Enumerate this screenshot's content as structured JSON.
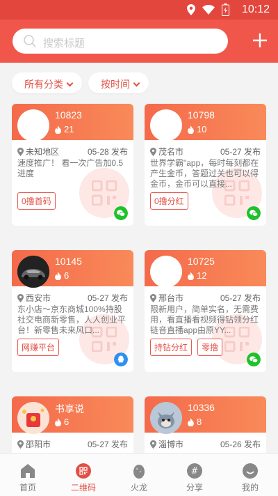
{
  "status_bar": {
    "time": "10:12"
  },
  "search": {
    "placeholder": "搜索标题"
  },
  "filters": [
    {
      "label": "所有分类"
    },
    {
      "label": "按时间"
    }
  ],
  "cards": [
    {
      "id": "10823",
      "heat": "21",
      "location": "未知地区",
      "date": "05-28 发布",
      "desc": "速度推广！ 看一次广告加0.5进度",
      "tags": [
        "0撸首码"
      ],
      "badge": "wechat-icon",
      "avatar": "blank"
    },
    {
      "id": "10798",
      "heat": "10",
      "location": "茂名市",
      "date": "05-27 发布",
      "desc": "世界学霸\"app，每时每刻都在产生金币，答题过关也可以得金币，金币可以直接...",
      "tags": [
        "0撸分红"
      ],
      "badge": "wechat-icon",
      "avatar": "blank"
    },
    {
      "id": "10145",
      "heat": "6",
      "location": "西安市",
      "date": "05-27 发布",
      "desc": "东小店～京东商城100%持股社交电商新零售，人人创业平台！新零售未来风口...",
      "tags": [
        "网赚平台"
      ],
      "badge": "qq-icon",
      "avatar": "car"
    },
    {
      "id": "10725",
      "heat": "12",
      "location": "邢台市",
      "date": "05-27 发布",
      "desc": "限新用户，简单实名，无需费用，看直播看视频得钻领分红 链音直播app由原YY...",
      "tags": [
        "持钻分红",
        "零撸"
      ],
      "badge": "wechat-icon",
      "avatar": "blank"
    },
    {
      "id": "书享说",
      "heat": "6",
      "location": "邵阳市",
      "date": "05-27 发布",
      "desc": "",
      "tags": [],
      "badge": "",
      "avatar": "red"
    },
    {
      "id": "10336",
      "heat": "8",
      "location": "淄博市",
      "date": "05-26 发布",
      "desc": "",
      "tags": [],
      "badge": "",
      "avatar": "cat"
    }
  ],
  "tabs": [
    {
      "label": "首页",
      "icon": "home-icon"
    },
    {
      "label": "二维码",
      "icon": "qrcode-icon"
    },
    {
      "label": "火龙",
      "icon": "egg-icon"
    },
    {
      "label": "分享",
      "icon": "hashtag-icon"
    },
    {
      "label": "我的",
      "icon": "smile-icon"
    }
  ],
  "colors": {
    "primary": "#f0574a",
    "accent": "#e24f45",
    "wechat": "#1ec12a",
    "qq": "#2f8ff0"
  }
}
